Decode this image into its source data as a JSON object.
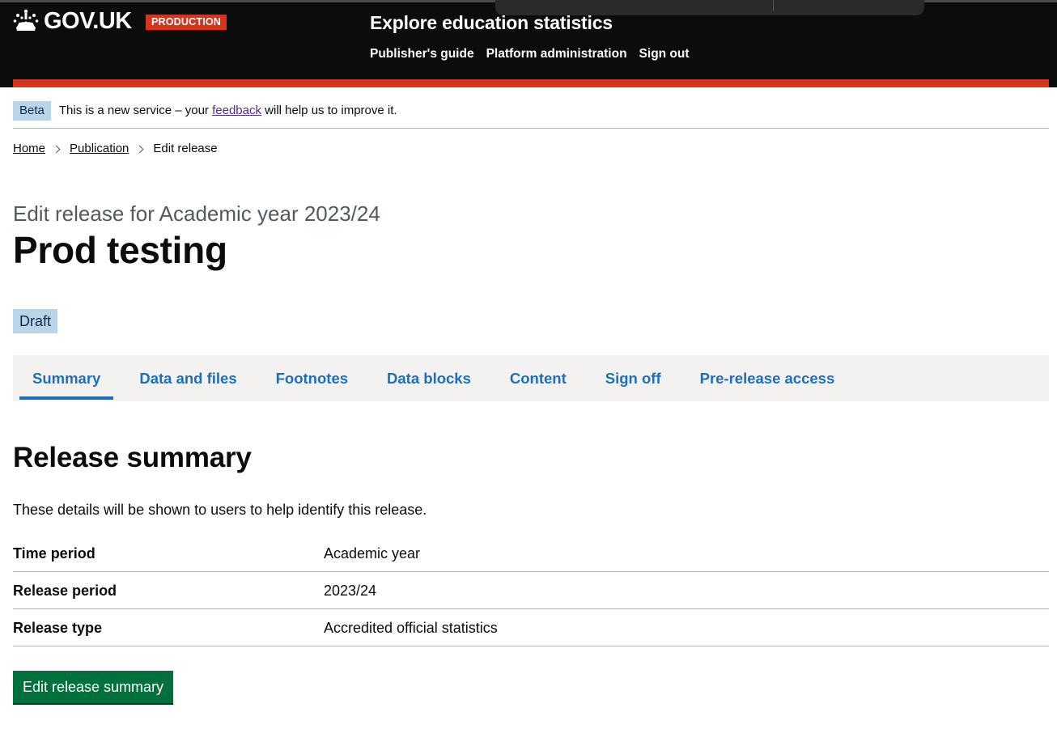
{
  "header": {
    "logo_text": "GOV.UK",
    "environment_tag": "PRODUCTION",
    "service_name": "Explore education statistics",
    "nav": [
      "Publisher's guide",
      "Platform administration",
      "Sign out"
    ],
    "brand_color": "#0b0c0c",
    "accent_color": "#d4351c"
  },
  "phase_banner": {
    "tag": "Beta",
    "text_before": "This is a new service – your",
    "link_text": "feedback",
    "text_after": "will help us to improve it."
  },
  "breadcrumbs": [
    "Home",
    "Publication",
    "Edit release"
  ],
  "page": {
    "caption": "Edit release for Academic year 2023/24",
    "title": "Prod testing",
    "status_tag": "Draft"
  },
  "tabs": [
    {
      "label": "Summary",
      "active": true
    },
    {
      "label": "Data and files"
    },
    {
      "label": "Footnotes"
    },
    {
      "label": "Data blocks"
    },
    {
      "label": "Content"
    },
    {
      "label": "Sign off"
    },
    {
      "label": "Pre-release access"
    }
  ],
  "release_summary": {
    "heading": "Release summary",
    "description": "These details will be shown to users to help identify this release.",
    "rows": [
      {
        "key": "Time period",
        "value": "Academic year"
      },
      {
        "key": "Release period",
        "value": "2023/24"
      },
      {
        "key": "Release type",
        "value": "Accredited official statistics"
      }
    ],
    "edit_button": "Edit release summary",
    "button_color": "#00703c"
  }
}
